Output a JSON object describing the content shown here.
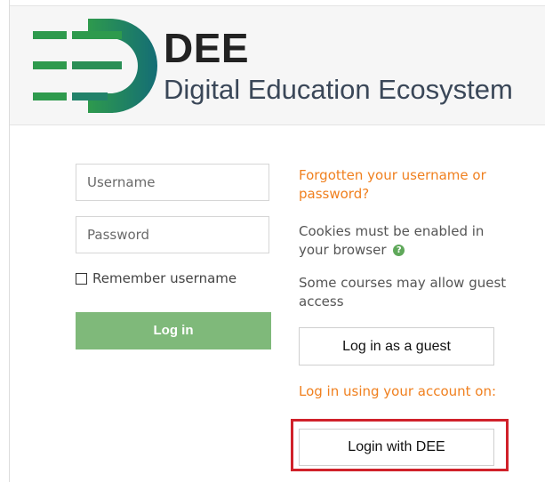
{
  "brand": {
    "short_name": "DEE",
    "full_name": "Digital Education Ecosystem",
    "colors": {
      "green": "#2e9a4d",
      "teal": "#146d75",
      "dark": "#222222"
    }
  },
  "form": {
    "username_placeholder": "Username",
    "password_placeholder": "Password",
    "remember_label": "Remember username",
    "login_button": "Log in"
  },
  "side": {
    "forgot_link": "Forgotten your username or password?",
    "cookies_text": "Cookies must be enabled in your browser",
    "guest_text": "Some courses may allow guest access",
    "guest_button": "Log in as a guest",
    "account_text": "Log in using your account on:",
    "dee_button": "Login with DEE"
  },
  "colors": {
    "accent_orange": "#f0801f",
    "login_green": "#7fb97a",
    "highlight_red": "#d0212a"
  }
}
